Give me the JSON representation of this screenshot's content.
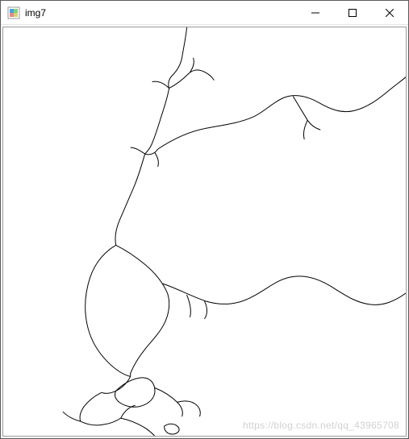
{
  "window": {
    "title": "img7",
    "icon_name": "app-icon"
  },
  "controls": {
    "minimize_title": "Minimize",
    "maximize_title": "Maximize",
    "close_title": "Close"
  },
  "watermark": "https://blog.csdn.net/qq_43965708"
}
